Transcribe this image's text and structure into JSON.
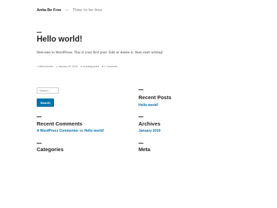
{
  "site": {
    "title": "Anita Be Free",
    "separator": "—",
    "description": "Time to be free"
  },
  "post": {
    "title": "Hello world!",
    "body": "Welcome to WordPress. This is your first post. Edit or delete it, then start writing!",
    "meta": {
      "author": "littlemeembo",
      "date": "January 29, 2019",
      "category": "Uncategorized",
      "comments": "1 Comment"
    }
  },
  "search": {
    "placeholder": "Search …",
    "button_label": "Search"
  },
  "widgets": {
    "recent_posts": {
      "title": "Recent Posts",
      "items": [
        "Hello world!"
      ]
    },
    "recent_comments": {
      "title": "Recent Comments",
      "author": "A WordPress Commenter",
      "connector": "on",
      "post": "Hello world!"
    },
    "archives": {
      "title": "Archives",
      "items": [
        "January 2019"
      ]
    },
    "categories": {
      "title": "Categories"
    },
    "meta": {
      "title": "Meta"
    }
  },
  "colors": {
    "accent": "#0073aa",
    "text": "#222222",
    "muted": "#767676"
  },
  "icons": {
    "author": "user-icon",
    "date": "calendar-icon",
    "category": "folder-icon",
    "comments": "comment-icon"
  }
}
